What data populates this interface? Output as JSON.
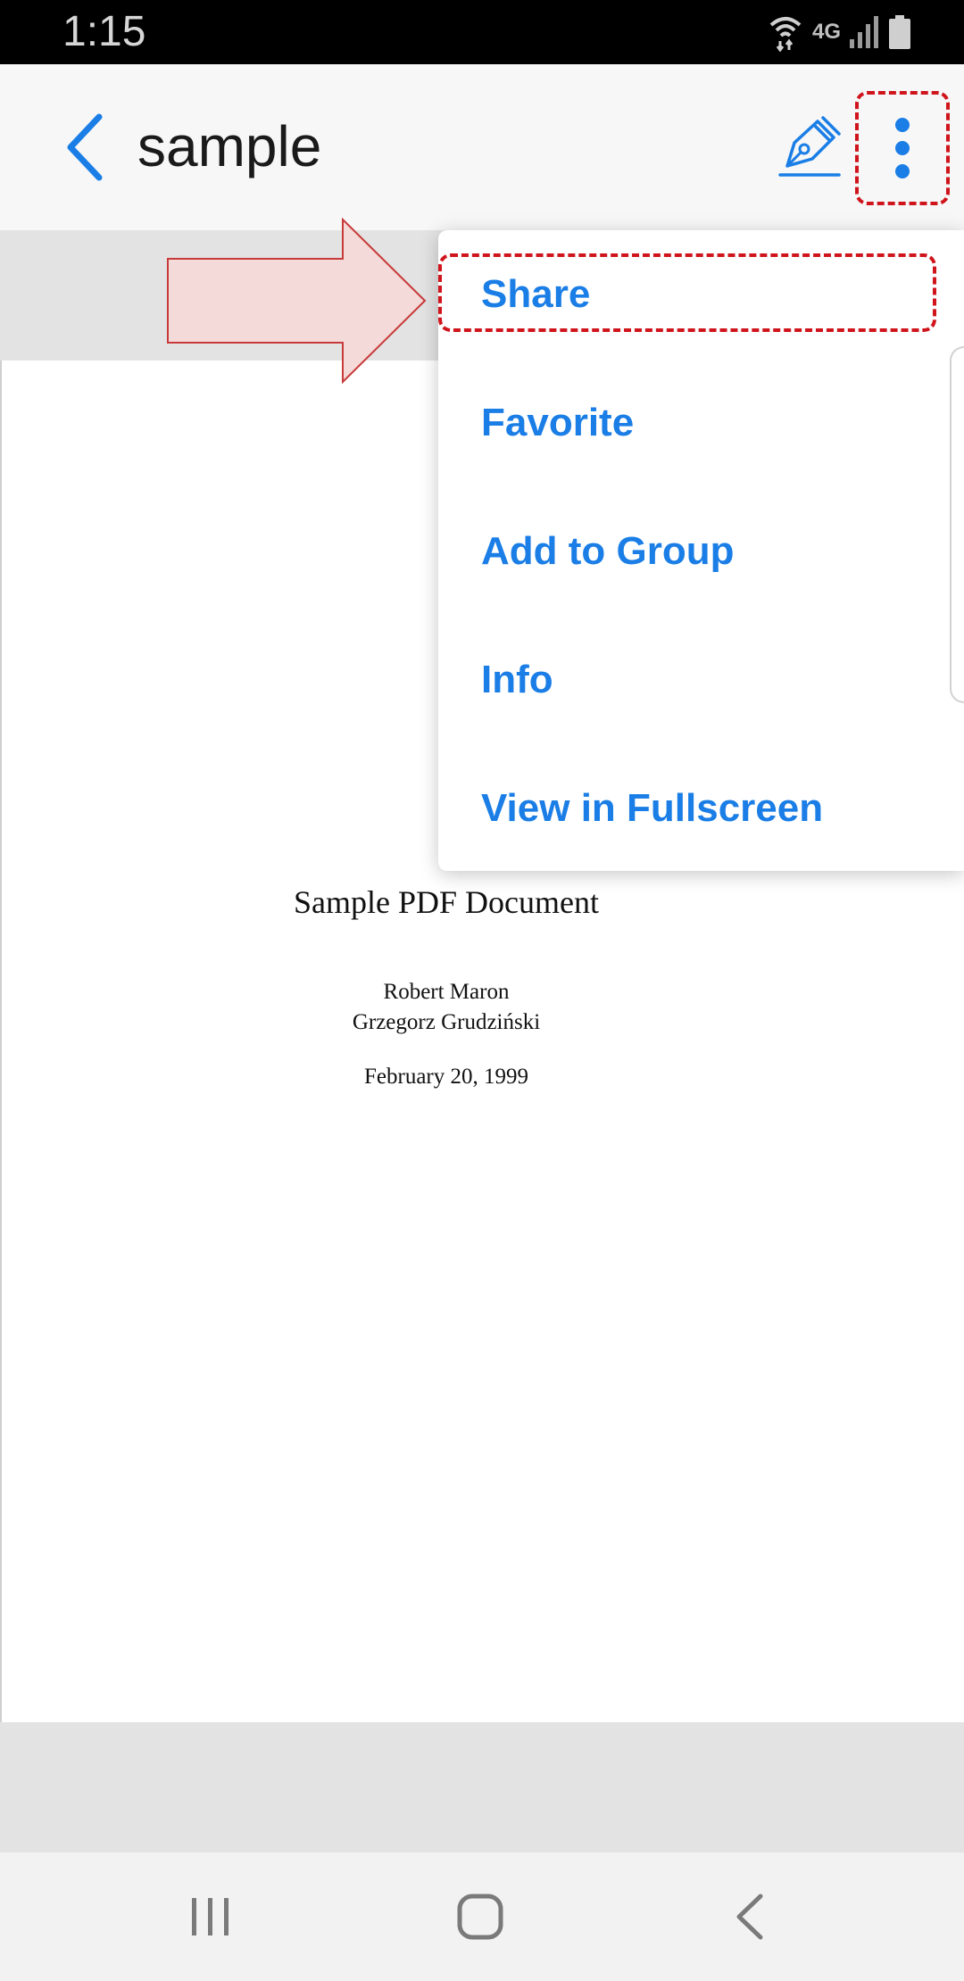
{
  "status_bar": {
    "time": "1:15",
    "network_label": "4G",
    "icons": [
      "wifi-icon",
      "signal-icon",
      "battery-icon"
    ]
  },
  "app_bar": {
    "title": "sample",
    "icons": [
      "back-arrow-icon",
      "pen-sign-icon",
      "more-vert-icon"
    ]
  },
  "menu": {
    "items": [
      {
        "label": "Share"
      },
      {
        "label": "Favorite"
      },
      {
        "label": "Add to Group"
      },
      {
        "label": "Info"
      },
      {
        "label": "View in Fullscreen"
      }
    ]
  },
  "document": {
    "title": "Sample PDF Document",
    "authors": [
      "Robert Maron",
      "Grzegorz Grudziński"
    ],
    "date": "February 20, 1999"
  },
  "nav_bar": {
    "icons": [
      "recents-icon",
      "home-icon",
      "back-icon"
    ]
  },
  "colors": {
    "accent": "#1a7ee6",
    "annotation_red": "#d0141c",
    "arrow_fill": "#f5dada"
  }
}
